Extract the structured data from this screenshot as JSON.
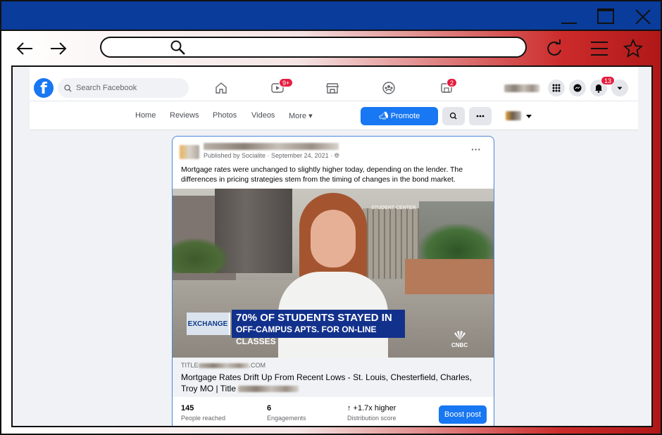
{
  "browser": {
    "url": ""
  },
  "facebook": {
    "search_placeholder": "Search Facebook",
    "watch_badge": "9+",
    "notif_center_badge": "2",
    "notifications_badge": "13",
    "subnav": {
      "tabs": [
        "Home",
        "Reviews",
        "Photos",
        "Videos",
        "More ▾"
      ],
      "promote_label": "Promote"
    }
  },
  "post": {
    "meta": "Published by Socialite · September 24, 2021 ·",
    "text": "Mortgage rates were unchanged to slightly higher today, depending on the lender. The differences in pricing strategies stem from the timing of changes in the bond market.",
    "video": {
      "exchange_label": "EXCHANGE",
      "headline_line1": "70% OF STUDENTS STAYED IN",
      "headline_line2": "OFF-CAMPUS APTS. FOR ON-LINE CLASSES",
      "network": "CNBC",
      "building_sign": "STUDENT CENTER"
    },
    "link": {
      "domain_prefix": "TITLE",
      "domain_suffix": ".COM",
      "title_line1": "Mortgage Rates Drift Up From Recent Lows - St. Louis, Chesterfield, Charles,",
      "title_line2": "Troy MO | Title"
    },
    "stats": {
      "reached_value": "145",
      "reached_label": "People reached",
      "engagements_value": "6",
      "engagements_label": "Engagements",
      "distribution_value": "↑ +1.7x higher",
      "distribution_label": "Distribution score"
    },
    "boost_label": "Boost post"
  },
  "colors": {
    "fb_blue": "#1877f2",
    "titlebar": "#0a3c9c",
    "badge_red": "#e41e3f"
  }
}
